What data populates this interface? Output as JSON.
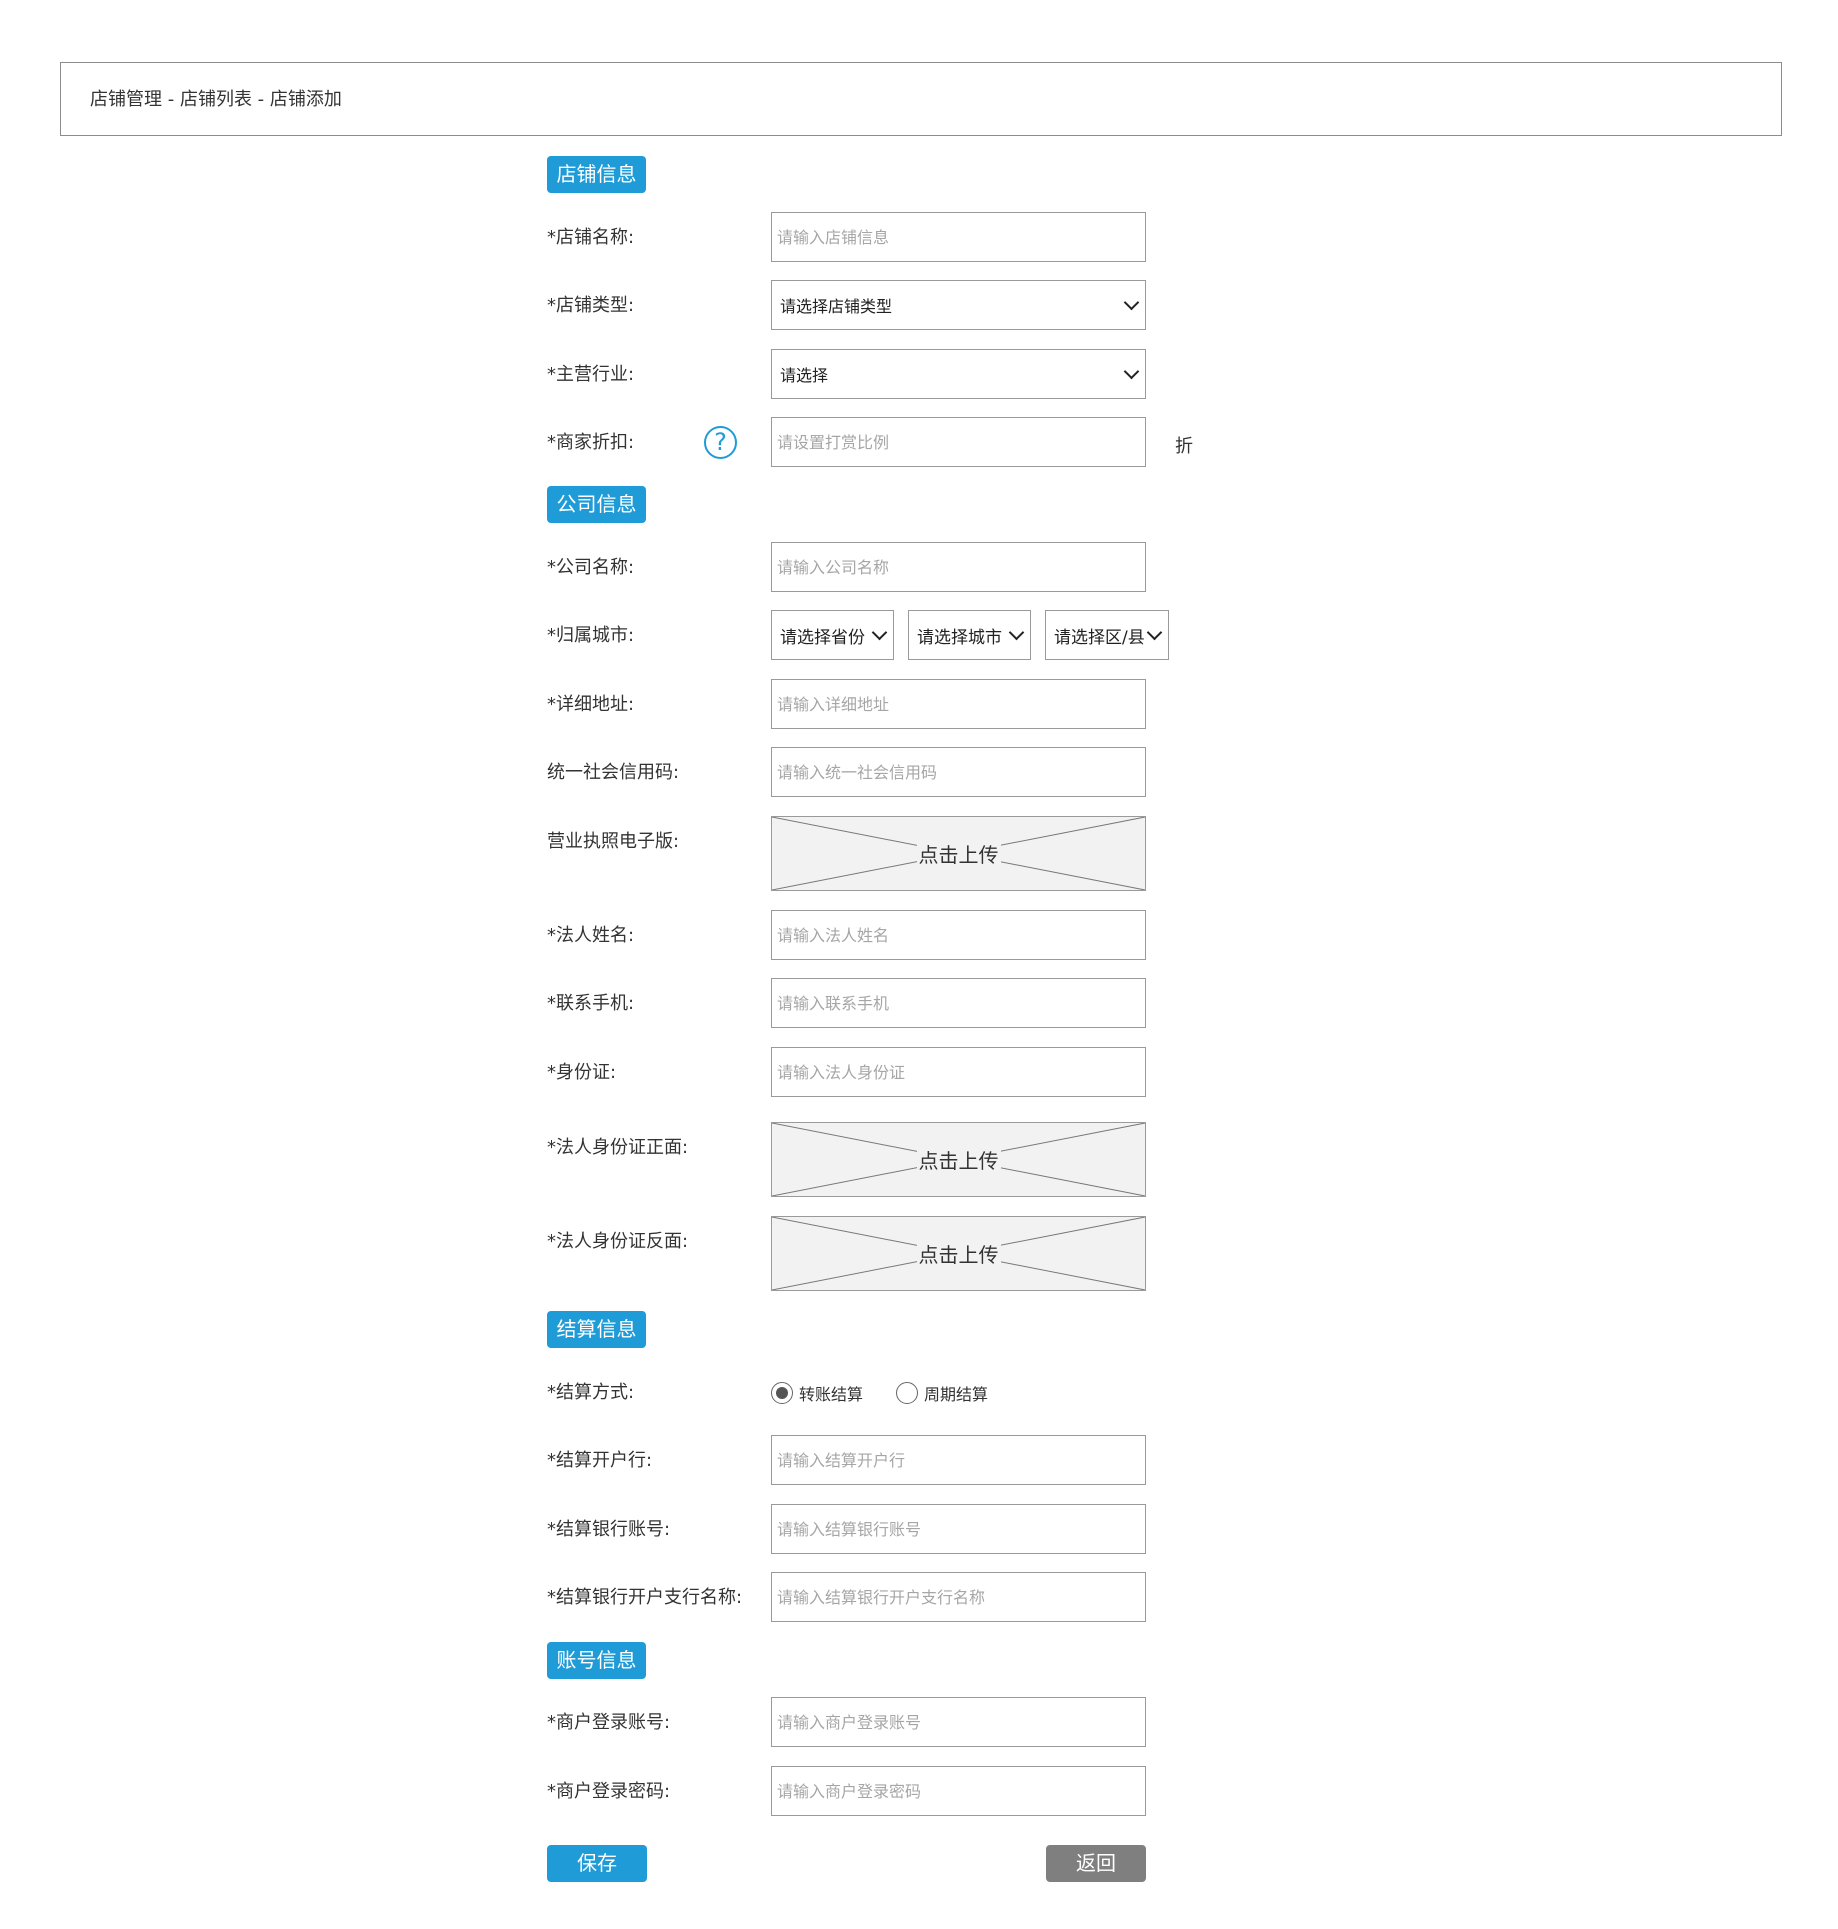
{
  "breadcrumb": {
    "item1": "店铺管理 -",
    "item2": "店铺列表 -",
    "item3": "店铺添加"
  },
  "sections": {
    "shop": "店铺信息",
    "company": "公司信息",
    "settlement": "结算信息",
    "account": "账号信息"
  },
  "shop": {
    "name_label": "*店铺名称:",
    "name_placeholder": "请输入店铺信息",
    "type_label": "*店铺类型:",
    "type_value": "请选择店铺类型",
    "industry_label": "*主营行业:",
    "industry_value": "请选择",
    "discount_label": "*商家折扣:",
    "discount_placeholder": "请设置打赏比例",
    "discount_unit": "折",
    "help_icon": "?"
  },
  "company": {
    "name_label": "*公司名称:",
    "name_placeholder": "请输入公司名称",
    "city_label": "*归属城市:",
    "province_value": "请选择省份",
    "city_value": "请选择城市",
    "district_value": "请选择区/县",
    "address_label": "*详细地址:",
    "address_placeholder": "请输入详细地址",
    "credit_label": "统一社会信用码:",
    "credit_placeholder": "请输入统一社会信用码",
    "license_label": "营业执照电子版:",
    "upload_text": "点击上传",
    "legal_name_label": "*法人姓名:",
    "legal_name_placeholder": "请输入法人姓名",
    "phone_label": "*联系手机:",
    "phone_placeholder": "请输入联系手机",
    "id_label": "*身份证:",
    "id_placeholder": "请输入法人身份证",
    "id_front_label": "*法人身份证正面:",
    "id_back_label": "*法人身份证反面:"
  },
  "settlement": {
    "method_label": "*结算方式:",
    "option1": "转账结算",
    "option2": "周期结算",
    "bank_label": "*结算开户行:",
    "bank_placeholder": "请输入结算开户行",
    "account_label": "*结算银行账号:",
    "account_placeholder": "请输入结算银行账号",
    "branch_label": "*结算银行开户支行名称:",
    "branch_placeholder": "请输入结算银行开户支行名称"
  },
  "account": {
    "login_label": "*商户登录账号:",
    "login_placeholder": "请输入商户登录账号",
    "password_label": "*商户登录密码:",
    "password_placeholder": "请输入商户登录密码"
  },
  "buttons": {
    "save": "保存",
    "back": "返回"
  },
  "colors": {
    "accent": "#1f9bd7",
    "back_button": "#7f7f7f",
    "upload_bg": "#f2f2f2"
  }
}
